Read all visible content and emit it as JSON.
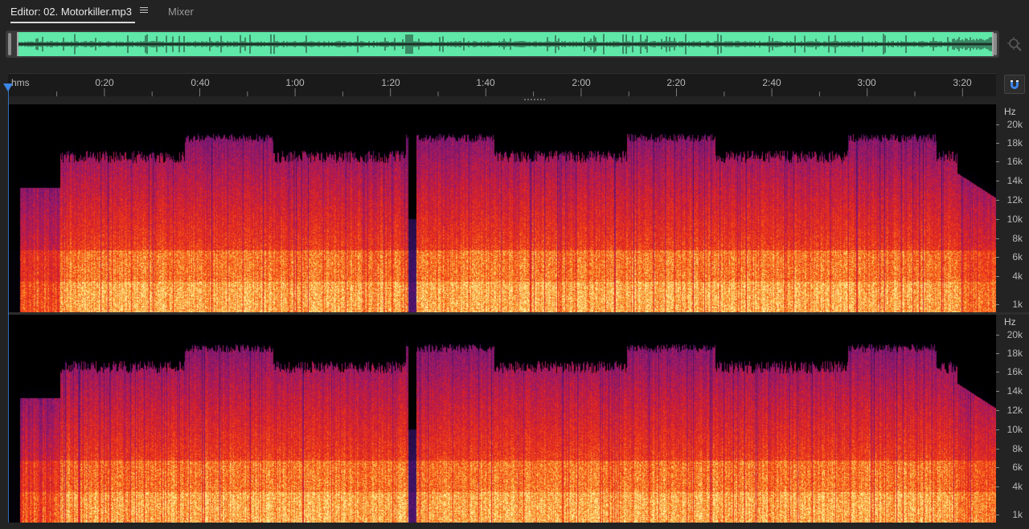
{
  "tabs": {
    "editor_label": "Editor: 02. Motorkiller.mp3",
    "mixer_label": "Mixer"
  },
  "ruler": {
    "unit_label": "hms",
    "marks": [
      "0:20",
      "0:40",
      "1:00",
      "1:20",
      "1:40",
      "2:00",
      "2:20",
      "2:40",
      "3:00",
      "3:20"
    ]
  },
  "spectral": {
    "unit": "Hz",
    "channel_1_labels": [
      "20k",
      "18k",
      "16k",
      "14k",
      "12k",
      "10k",
      "8k",
      "6k",
      "4k",
      "1k"
    ],
    "channel_2_labels": [
      "20k",
      "18k",
      "16k",
      "14k",
      "12k",
      "10k",
      "8k",
      "6k",
      "4k",
      "1k"
    ]
  },
  "colors": {
    "waveform_bg": "#5fe8a8",
    "playhead": "#3a86e8",
    "accent": "#3a86e8"
  },
  "icons": {
    "tab_menu": "hamburger-menu-icon",
    "zoom": "zoom-icon",
    "snap": "magnet-icon"
  }
}
